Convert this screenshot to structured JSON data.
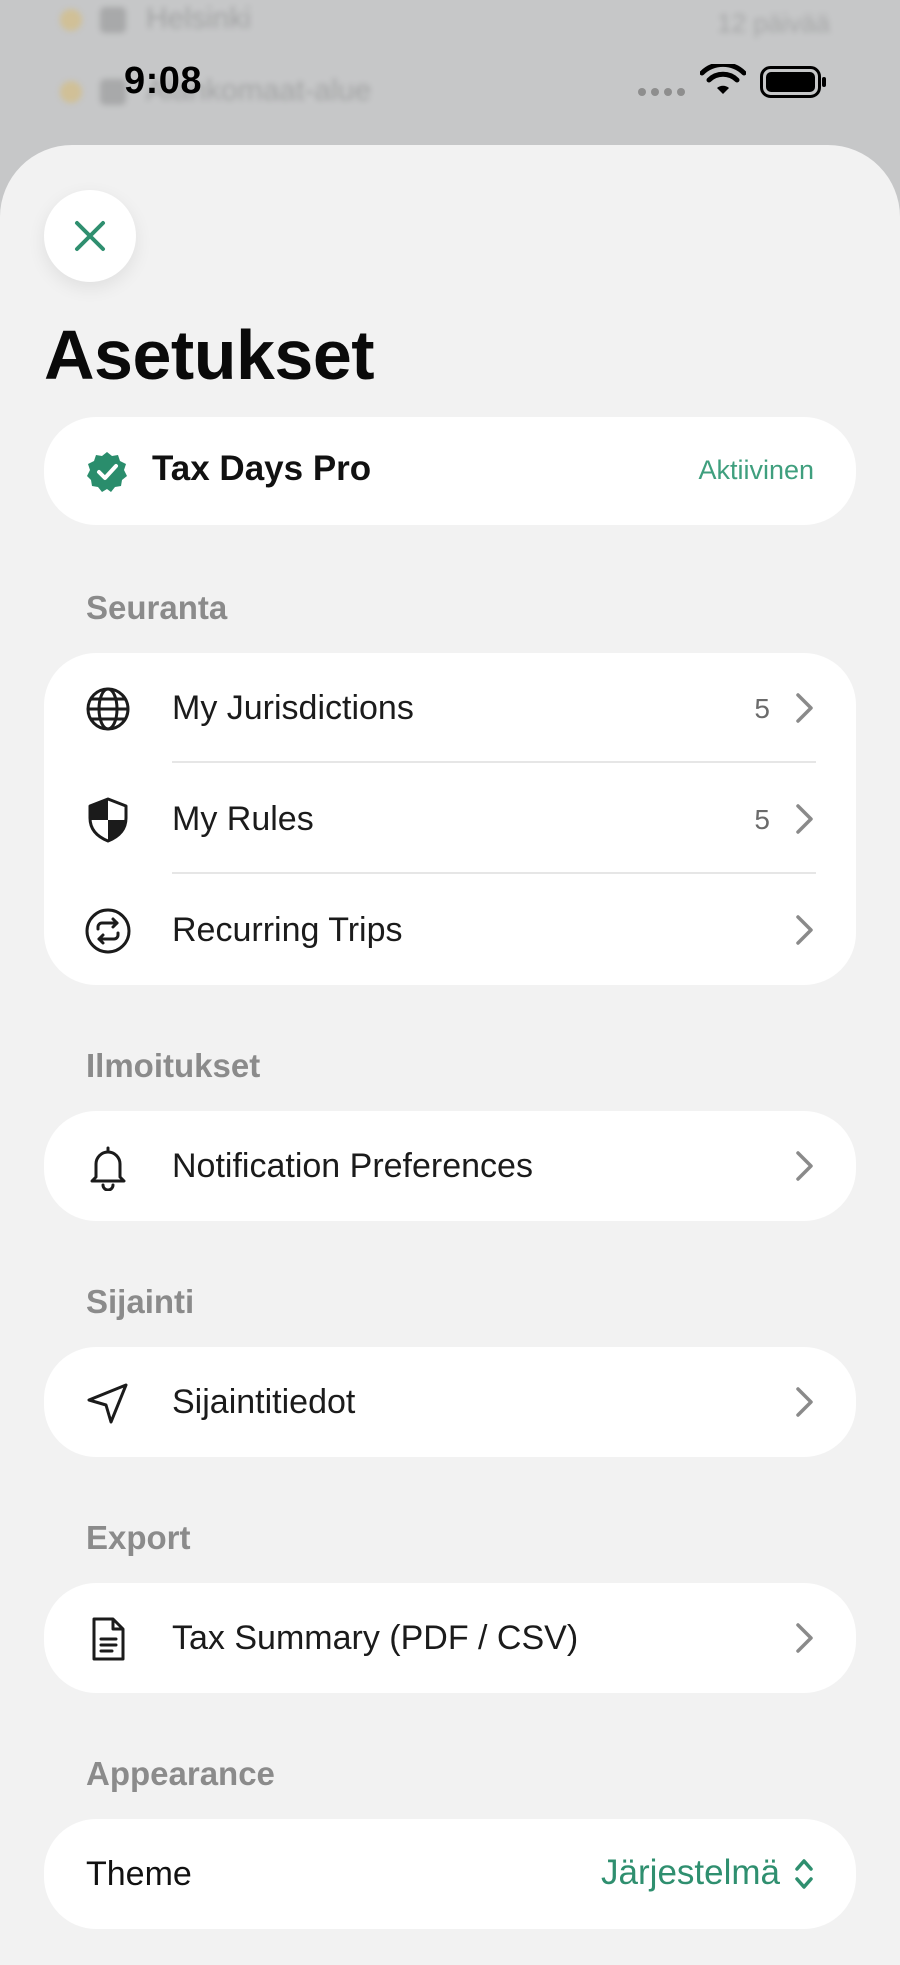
{
  "background_app": {
    "row1_text": "Helsinki",
    "row1_right": "12 päivää",
    "row2_text": "Alankomaat-alue"
  },
  "status_bar": {
    "time": "9:08"
  },
  "settings": {
    "title": "Asetukset",
    "pro": {
      "name": "Tax Days Pro",
      "status": "Aktiivinen"
    },
    "sections": {
      "tracking": {
        "label": "Seuranta",
        "items": [
          {
            "label": "My Jurisdictions",
            "count": "5",
            "icon": "globe-icon"
          },
          {
            "label": "My Rules",
            "count": "5",
            "icon": "shield-icon"
          },
          {
            "label": "Recurring Trips",
            "count": "",
            "icon": "repeat-icon"
          }
        ]
      },
      "notifications": {
        "label": "Ilmoitukset",
        "items": [
          {
            "label": "Notification Preferences",
            "icon": "bell-icon"
          }
        ]
      },
      "location": {
        "label": "Sijainti",
        "items": [
          {
            "label": "Sijaintitiedot",
            "icon": "location-arrow-icon"
          }
        ]
      },
      "export": {
        "label": "Export",
        "items": [
          {
            "label": "Tax Summary (PDF / CSV)",
            "icon": "document-icon"
          }
        ]
      },
      "appearance": {
        "label": "Appearance",
        "theme_label": "Theme",
        "theme_value": "Järjestelmä"
      }
    },
    "colors": {
      "accent": "#2f8f6f",
      "sheet_bg": "#f2f2f2",
      "card_bg": "#ffffff"
    }
  }
}
